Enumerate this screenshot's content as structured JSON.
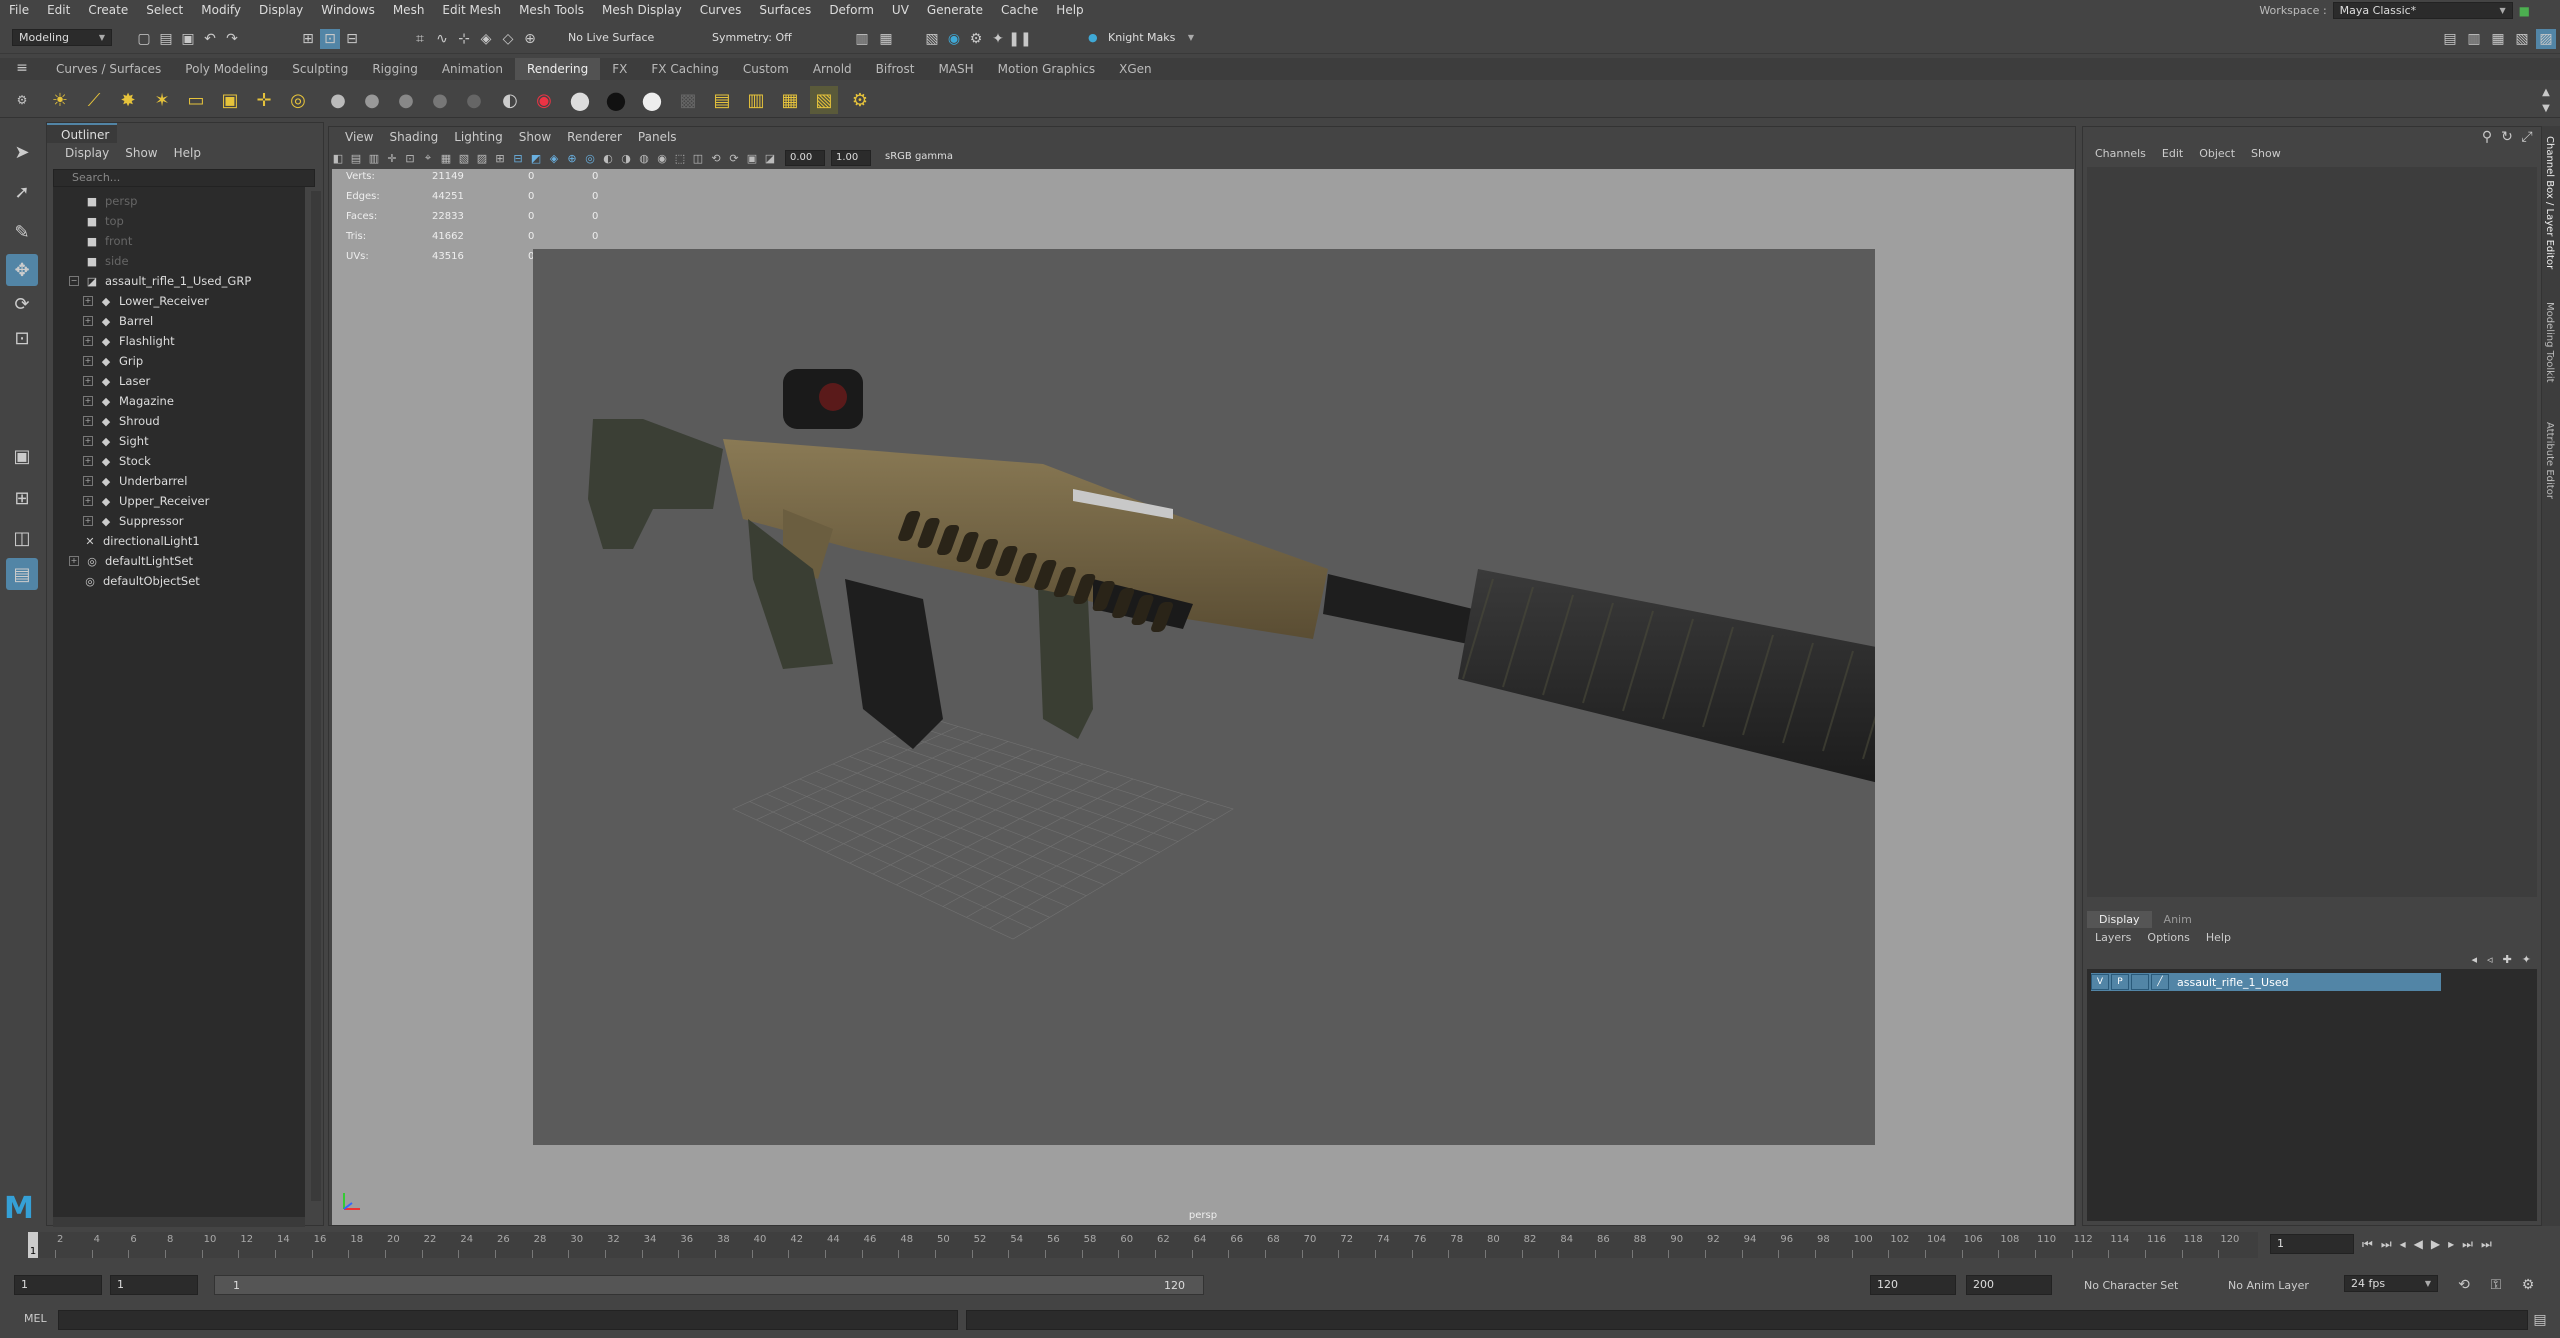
{
  "menubar": {
    "items": [
      "File",
      "Edit",
      "Create",
      "Select",
      "Modify",
      "Display",
      "Windows",
      "Mesh",
      "Edit Mesh",
      "Mesh Tools",
      "Mesh Display",
      "Curves",
      "Surfaces",
      "Deform",
      "UV",
      "Generate",
      "Cache",
      "Help"
    ],
    "workspace_label": "Workspace :",
    "workspace_value": "Maya Classic*"
  },
  "statusline": {
    "mode": "Modeling",
    "live_surface": "No Live Surface",
    "symmetry": "Symmetry: Off",
    "user": "Knight Maks"
  },
  "shelf": {
    "tabs": [
      "Curves / Surfaces",
      "Poly Modeling",
      "Sculpting",
      "Rigging",
      "Animation",
      "Rendering",
      "FX",
      "FX Caching",
      "Custom",
      "Arnold",
      "Bifrost",
      "MASH",
      "Motion Graphics",
      "XGen"
    ],
    "active_tab": "Rendering"
  },
  "outliner": {
    "title": "Outliner",
    "menu": [
      "Display",
      "Show",
      "Help"
    ],
    "search_placeholder": "Search...",
    "cameras": [
      "persp",
      "top",
      "front",
      "side"
    ],
    "group": "assault_rifle_1_Used_GRP",
    "children": [
      "Lower_Receiver",
      "Barrel",
      "Flashlight",
      "Grip",
      "Laser",
      "Magazine",
      "Shroud",
      "Sight",
      "Stock",
      "Underbarrel",
      "Upper_Receiver",
      "Suppressor"
    ],
    "others": [
      "directionalLight1",
      "defaultLightSet",
      "defaultObjectSet"
    ]
  },
  "viewport": {
    "menu": [
      "View",
      "Shading",
      "Lighting",
      "Show",
      "Renderer",
      "Panels"
    ],
    "exposure": "0.00",
    "gamma": "1.00",
    "colorspace": "sRGB gamma",
    "camera": "persp",
    "hud": [
      {
        "label": "Verts:",
        "a": "21149",
        "b": "0",
        "c": "0"
      },
      {
        "label": "Edges:",
        "a": "44251",
        "b": "0",
        "c": "0"
      },
      {
        "label": "Faces:",
        "a": "22833",
        "b": "0",
        "c": "0"
      },
      {
        "label": "Tris:",
        "a": "41662",
        "b": "0",
        "c": "0"
      },
      {
        "label": "UVs:",
        "a": "43516",
        "b": "0",
        "c": "0"
      }
    ]
  },
  "channelbox": {
    "menu": [
      "Channels",
      "Edit",
      "Object",
      "Show"
    ],
    "layer_tabs": [
      "Display",
      "Anim"
    ],
    "layer_menu": [
      "Layers",
      "Options",
      "Help"
    ],
    "layer": {
      "v": "V",
      "p": "P",
      "name": "assault_rifle_1_Used"
    },
    "side_tabs": [
      "Channel Box / Layer Editor",
      "Modeling Toolkit",
      "Attribute Editor"
    ]
  },
  "timeline": {
    "ticks": [
      "2",
      "4",
      "6",
      "8",
      "10",
      "12",
      "14",
      "16",
      "18",
      "20",
      "22",
      "24",
      "26",
      "28",
      "30",
      "32",
      "34",
      "36",
      "38",
      "40",
      "42",
      "44",
      "46",
      "48",
      "50",
      "52",
      "54",
      "56",
      "58",
      "60",
      "62",
      "64",
      "66",
      "68",
      "70",
      "72",
      "74",
      "76",
      "78",
      "80",
      "82",
      "84",
      "86",
      "88",
      "90",
      "92",
      "94",
      "96",
      "98",
      "100",
      "102",
      "104",
      "106",
      "108",
      "110",
      "112",
      "114",
      "116",
      "118",
      "120"
    ],
    "current": "1",
    "current_field": "1"
  },
  "range": {
    "start": "1",
    "start2": "1",
    "slider_start": "1",
    "slider_end": "120",
    "end": "120",
    "end2": "200",
    "character_set": "No Character Set",
    "anim_layer": "No Anim Layer",
    "fps": "24 fps"
  },
  "cmdline": {
    "label": "MEL"
  },
  "colors": {
    "accent": "#5285a6",
    "panel": "#444444",
    "dark": "#2b2b2b"
  }
}
